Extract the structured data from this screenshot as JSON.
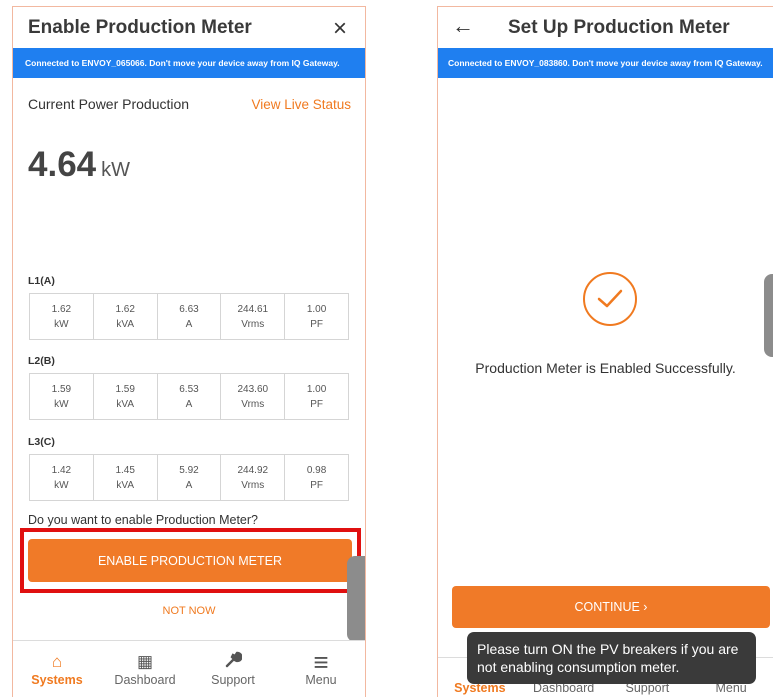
{
  "left": {
    "title": "Enable Production Meter",
    "close_icon": "×",
    "banner": "Connected to ENVOY_065066. Don't move your device away from IQ Gateway.",
    "current_power_label": "Current Power Production",
    "view_live_status": "View Live Status",
    "power_value": "4.64",
    "power_unit": "kW",
    "phases": [
      {
        "label": "L1(A)",
        "cells": [
          [
            "1.62",
            "kW"
          ],
          [
            "1.62",
            "kVA"
          ],
          [
            "6.63",
            "A"
          ],
          [
            "244.61",
            "Vrms"
          ],
          [
            "1.00",
            "PF"
          ]
        ]
      },
      {
        "label": "L2(B)",
        "cells": [
          [
            "1.59",
            "kW"
          ],
          [
            "1.59",
            "kVA"
          ],
          [
            "6.53",
            "A"
          ],
          [
            "243.60",
            "Vrms"
          ],
          [
            "1.00",
            "PF"
          ]
        ]
      },
      {
        "label": "L3(C)",
        "cells": [
          [
            "1.42",
            "kW"
          ],
          [
            "1.45",
            "kVA"
          ],
          [
            "5.92",
            "A"
          ],
          [
            "244.92",
            "Vrms"
          ],
          [
            "0.98",
            "PF"
          ]
        ]
      }
    ],
    "question": "Do you want to enable Production Meter?",
    "enable_button": "ENABLE PRODUCTION METER",
    "not_now": "NOT NOW",
    "tabs": [
      {
        "label": "Systems",
        "icon": "home-icon",
        "glyph": "⌂",
        "active": true
      },
      {
        "label": "Dashboard",
        "icon": "dashboard-icon",
        "glyph": "▦",
        "active": false
      },
      {
        "label": "Support",
        "icon": "wrench-icon",
        "glyph": "🔧",
        "active": false
      },
      {
        "label": "Menu",
        "icon": "menu-icon",
        "glyph": "≡",
        "active": false
      }
    ]
  },
  "right": {
    "title": "Set Up Production Meter",
    "back_icon": "←",
    "banner": "Connected to ENVOY_083860. Don't move your device away from IQ Gateway.",
    "success_text": "Production Meter is Enabled Successfully.",
    "continue_button": "CONTINUE  ›",
    "toast": "Please turn ON the PV breakers if you are not enabling consumption meter.",
    "tabs": [
      {
        "label": "Systems",
        "active": true
      },
      {
        "label": "Dashboard",
        "active": false
      },
      {
        "label": "Support",
        "active": false
      },
      {
        "label": "Menu",
        "active": false
      }
    ]
  },
  "colors": {
    "accent": "#f07a28",
    "banner_blue": "#1f7ff0",
    "highlight_red": "#e01010"
  }
}
